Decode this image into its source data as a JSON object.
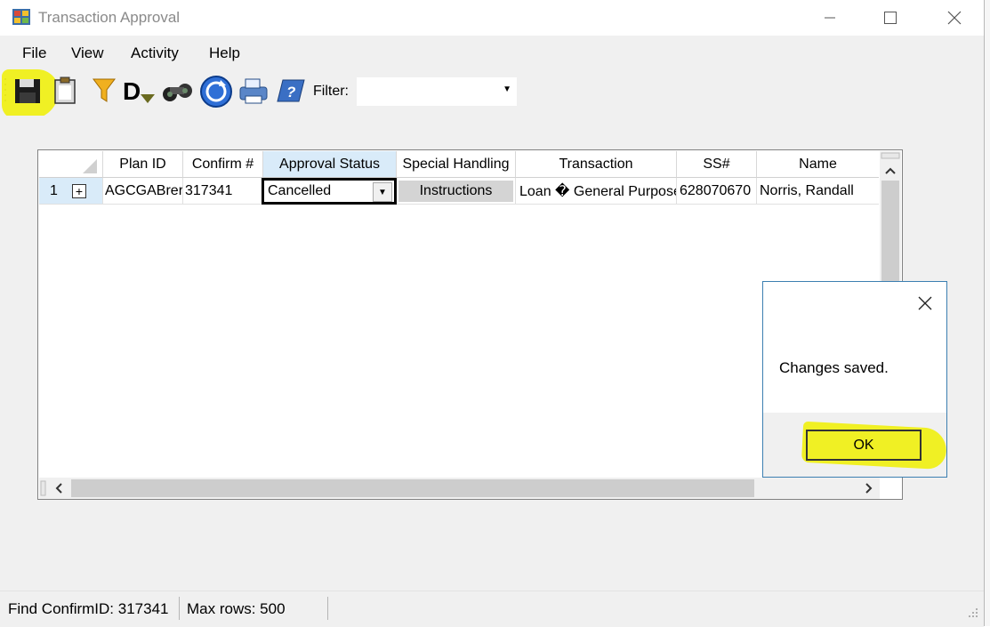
{
  "window": {
    "title": "Transaction Approval"
  },
  "menu": [
    "File",
    "View",
    "Activity",
    "Help"
  ],
  "toolbar": {
    "icons": [
      "save-icon",
      "clipboard-icon",
      "filter-funnel-icon",
      "d-down-icon",
      "binoculars-icon",
      "refresh-icon",
      "print-icon",
      "help-book-icon"
    ],
    "filter_label": "Filter:",
    "filter_value": ""
  },
  "grid": {
    "columns": [
      "Plan ID",
      "Confirm #",
      "Approval Status",
      "Special Handling",
      "Transaction",
      "SS#",
      "Name"
    ],
    "rows": [
      {
        "row_number": "1",
        "expander": "+",
        "plan_id": "AGCGABrer",
        "confirm": "317341",
        "approval_status": "Cancelled",
        "special_handling": "Instructions",
        "transaction": "Loan � General Purpose",
        "ssn": "628070670",
        "name": "Norris, Randall"
      }
    ]
  },
  "status": {
    "find": "Find ConfirmID: 317341",
    "max_rows": "Max rows: 500"
  },
  "dialog": {
    "message": "Changes saved.",
    "ok_label": "OK"
  },
  "colors": {
    "highlight": "#f0f000",
    "active_header": "#d9ebf9",
    "dialog_border": "#3c7fb1"
  }
}
